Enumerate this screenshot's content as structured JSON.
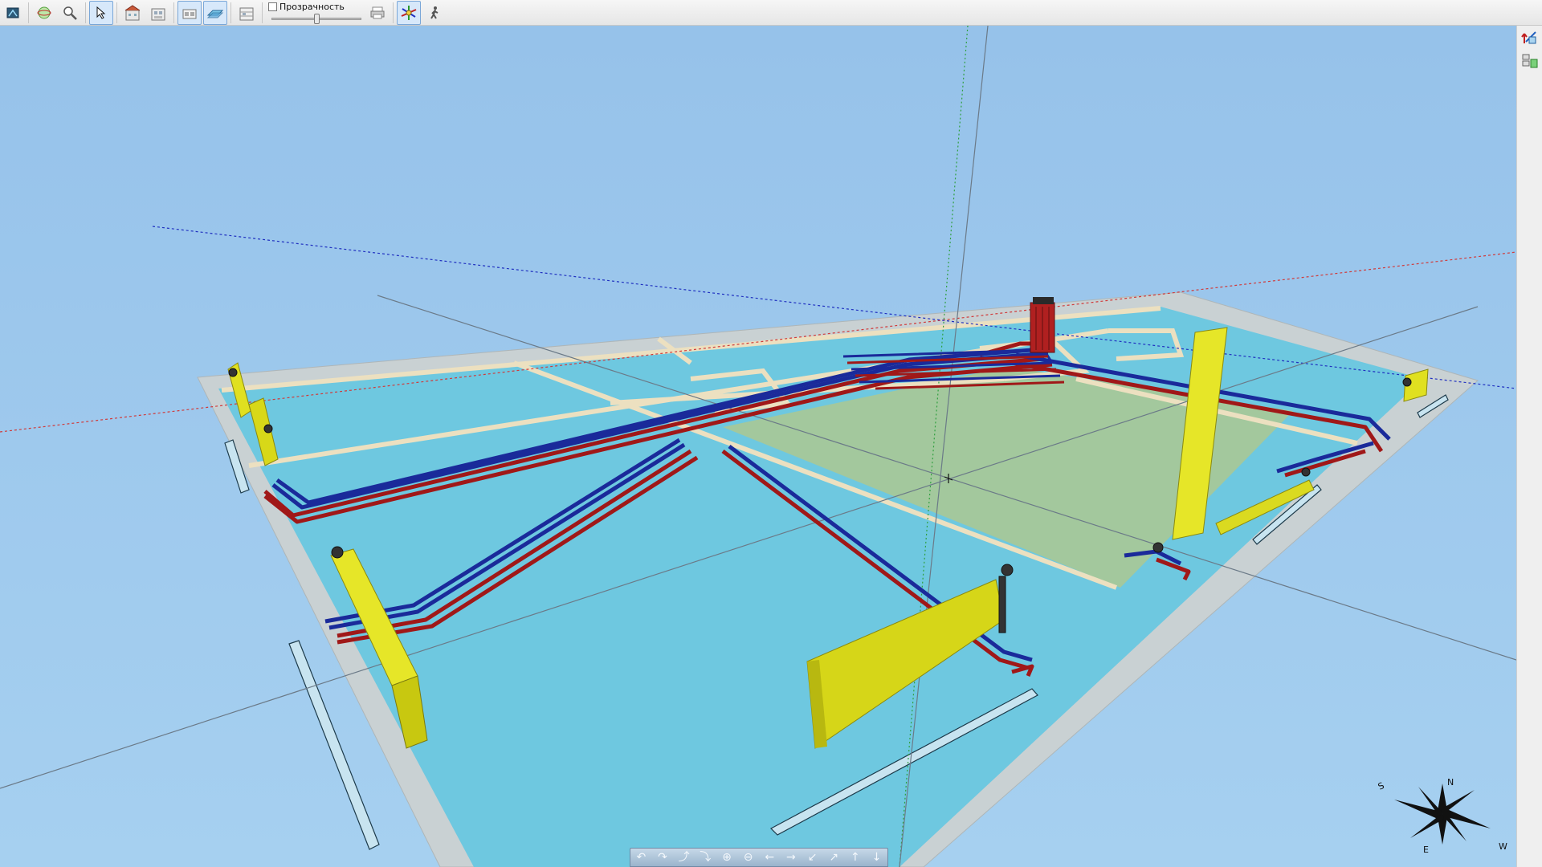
{
  "toolbar": {
    "transparency_label": "Прозрачность",
    "transparency_value": 0.5,
    "buttons": [
      {
        "name": "view-mode-icon",
        "active": false
      },
      {
        "name": "orbit-icon",
        "active": false
      },
      {
        "name": "zoom-icon",
        "active": false
      },
      {
        "name": "select-cursor-icon",
        "active": true
      },
      {
        "name": "building-view-icon",
        "active": false
      },
      {
        "name": "floor-view-icon",
        "active": false
      },
      {
        "name": "section-view-icon",
        "active": true
      },
      {
        "name": "plan-view-icon",
        "active": true
      },
      {
        "name": "level-view-icon",
        "active": false
      },
      {
        "name": "print-icon",
        "active": false
      },
      {
        "name": "axes-icon",
        "active": true
      },
      {
        "name": "walk-icon",
        "active": false
      }
    ]
  },
  "side_panel": {
    "buttons": [
      "axis-arrows-icon",
      "layers-icon"
    ]
  },
  "compass": {
    "labels": [
      "S",
      "N",
      "E",
      "W"
    ]
  },
  "navbar": {
    "buttons": [
      {
        "name": "rotate-left-icon",
        "glyph": "↶"
      },
      {
        "name": "rotate-right-icon",
        "glyph": "↷"
      },
      {
        "name": "tilt-up-icon",
        "glyph": "⤴"
      },
      {
        "name": "tilt-down-icon",
        "glyph": "⤵"
      },
      {
        "name": "zoom-in-icon",
        "glyph": "⊕"
      },
      {
        "name": "zoom-out-icon",
        "glyph": "⊖"
      },
      {
        "name": "pan-left-icon",
        "glyph": "←"
      },
      {
        "name": "pan-right-icon",
        "glyph": "→"
      },
      {
        "name": "pan-down-left-icon",
        "glyph": "↙"
      },
      {
        "name": "pan-up-right-icon",
        "glyph": "↗"
      },
      {
        "name": "pan-up-icon",
        "glyph": "↑"
      },
      {
        "name": "pan-down-icon",
        "glyph": "↓"
      }
    ]
  },
  "colors": {
    "sky": "#9cc8ec",
    "floor": "#6ec8e0",
    "wall": "#c9d1d3",
    "room_highlight": "#a8c896",
    "partition": "#ece0c0",
    "pipe_supply": "#a01818",
    "pipe_return": "#1a2a9a",
    "radiator": "#e0e020",
    "boiler": "#b02020"
  }
}
